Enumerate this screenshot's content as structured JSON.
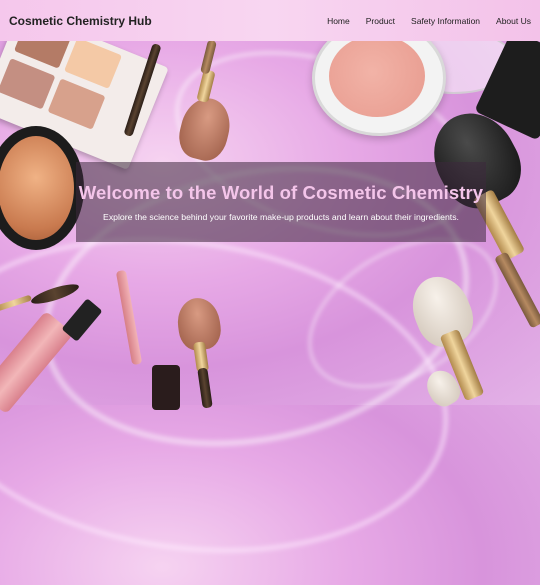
{
  "header": {
    "brand": "Cosmetic Chemistry Hub",
    "nav": [
      "Home",
      "Product",
      "Safety Information",
      "About Us"
    ]
  },
  "hero": {
    "title": "Welcome to the World of Cosmetic Chemistry",
    "subtitle": "Explore the science behind your favorite make-up products and learn about their ingredients."
  },
  "colors": {
    "header_bg": "#f6cdee",
    "hero_title": "#f4c5ea",
    "background": "#d894dc"
  }
}
